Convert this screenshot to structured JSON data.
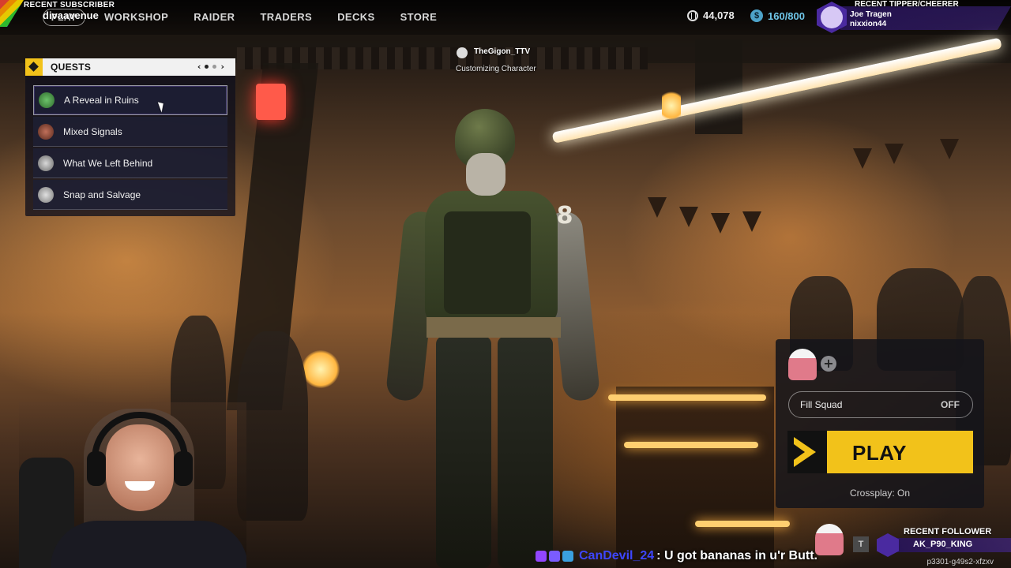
{
  "colors": {
    "accent": "#f2c21a",
    "credits": "#6fc6e8",
    "chat_user": "#3d46ff",
    "overlay_purple": "#4a2aa0"
  },
  "nav": {
    "items": [
      {
        "label": "PLAY",
        "icon": ""
      },
      {
        "label": "WORKSHOP"
      },
      {
        "label": "RAIDER"
      },
      {
        "label": "TRADERS"
      },
      {
        "label": "DECKS"
      },
      {
        "label": "STORE"
      }
    ],
    "coins": "44,078",
    "credits": "160/800",
    "coin_icon": "coin-icon",
    "credits_icon": "credits-icon"
  },
  "overlay": {
    "subscriber_title": "RECENT SUBSCRIBER",
    "subscriber_name": "divaavenue",
    "tipper_title": "RECENT TIPPER/CHEERER",
    "tipper_line1": "Joe Tragen",
    "tipper_line2": "nixxion44",
    "follower_title": "RECENT FOLLOWER",
    "follower_name": "AK_P90_KING",
    "follower_t": "T"
  },
  "quests": {
    "title": "QUESTS",
    "pager_prev": "‹",
    "pager_next": "›",
    "items": [
      {
        "label": "A Reveal in Ruins",
        "avatar_color": "#3f8a3a"
      },
      {
        "label": "Mixed Signals",
        "avatar_color": "#8a3a2a"
      },
      {
        "label": "What We Left Behind",
        "avatar_color": "#9a9a9a"
      },
      {
        "label": "Snap and Salvage",
        "avatar_color": "#b8b8b8"
      }
    ]
  },
  "player": {
    "name": "TheGigon_TTV",
    "status": "Customizing Character"
  },
  "character": {
    "number": "8"
  },
  "play_panel": {
    "add_label": "+",
    "fill_squad_label": "Fill Squad",
    "fill_squad_state": "OFF",
    "play_label": "PLAY",
    "crossplay": "Crossplay: On"
  },
  "chat": {
    "user": "CanDevil_24",
    "message": ": U got bananas in u'r Butt."
  },
  "build_id": "p3301-g49s2-xfzxv"
}
